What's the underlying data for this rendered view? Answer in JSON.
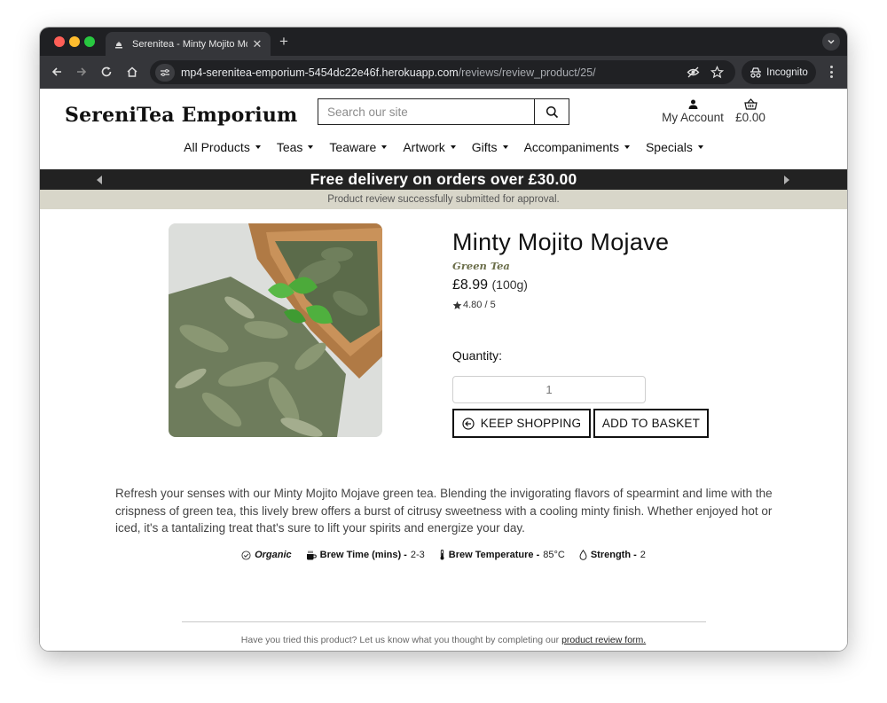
{
  "browser": {
    "tab_title": "Serenitea - Minty Mojito Moja",
    "url_host": "mp4-serenitea-emporium-5454dc22e46f.herokuapp.com",
    "url_path": "/reviews/review_product/25/",
    "incognito_label": "Incognito"
  },
  "header": {
    "logo": "SereniTea Emporium",
    "search_placeholder": "Search our site",
    "account_label": "My Account",
    "basket_total": "£0.00"
  },
  "nav": {
    "items": [
      {
        "label": "All Products"
      },
      {
        "label": "Teas"
      },
      {
        "label": "Teaware"
      },
      {
        "label": "Artwork"
      },
      {
        "label": "Gifts"
      },
      {
        "label": "Accompaniments"
      },
      {
        "label": "Specials"
      }
    ]
  },
  "promo": {
    "text": "Free delivery on orders over £30.00"
  },
  "notice": {
    "text": "Product review successfully submitted for approval."
  },
  "product": {
    "name": "Minty Mojito Mojave",
    "category": "Green Tea",
    "price": "£8.99",
    "weight": "(100g)",
    "rating": "4.80 / 5",
    "quantity_label": "Quantity:",
    "quantity_value": "1",
    "keep_shopping_label": "KEEP SHOPPING",
    "add_to_basket_label": "ADD TO BASKET",
    "description": "Refresh your senses with our Minty Mojito Mojave green tea. Blending the invigorating flavors of spearmint and lime with the crispness of green tea, this lively brew offers a burst of citrusy sweetness with a cooling minty finish. Whether enjoyed hot or iced, it's a tantalizing treat that's sure to lift your spirits and energize your day."
  },
  "attributes": {
    "organic": "Organic",
    "brew_time_label": "Brew Time (mins) -",
    "brew_time_value": "2-3",
    "brew_temp_label": "Brew Temperature -",
    "brew_temp_value": "85°C",
    "strength_label": "Strength -",
    "strength_value": "2"
  },
  "review_prompt": {
    "text": "Have you tried this product? Let us know what you thought by completing our",
    "link": "product review form."
  },
  "colors": {
    "promo_bg": "#222222",
    "notice_bg": "#d8d6c9",
    "category_text": "#6b6e4a"
  }
}
